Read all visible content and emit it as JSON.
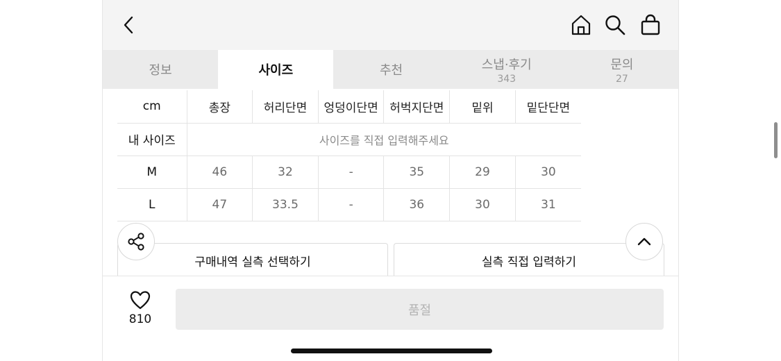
{
  "tabs": [
    {
      "label": "정보",
      "count": ""
    },
    {
      "label": "사이즈",
      "count": ""
    },
    {
      "label": "추천",
      "count": ""
    },
    {
      "label": "스냅·후기",
      "count": "343"
    },
    {
      "label": "문의",
      "count": "27"
    }
  ],
  "active_tab": "사이즈",
  "size_table": {
    "unit": "cm",
    "columns": [
      "총장",
      "허리단면",
      "엉덩이단면",
      "허벅지단면",
      "밑위",
      "밑단단면"
    ],
    "my_size_label": "내 사이즈",
    "my_size_placeholder": "사이즈를 직접 입력해주세요",
    "rows": [
      {
        "size": "M",
        "values": [
          "46",
          "32",
          "-",
          "35",
          "29",
          "30"
        ]
      },
      {
        "size": "L",
        "values": [
          "47",
          "33.5",
          "-",
          "36",
          "30",
          "31"
        ]
      }
    ]
  },
  "buttons": {
    "purchase_history": "구매내역 실측 선택하기",
    "manual_input": "실측 직접 입력하기",
    "soldout": "품절"
  },
  "like": {
    "count": "810"
  },
  "icons": {
    "back": "chevron-left-icon",
    "home": "home-icon",
    "search": "search-icon",
    "bag": "shopping-bag-icon",
    "share": "share-icon",
    "scroll_top": "chevron-up-icon",
    "like": "heart-icon"
  }
}
